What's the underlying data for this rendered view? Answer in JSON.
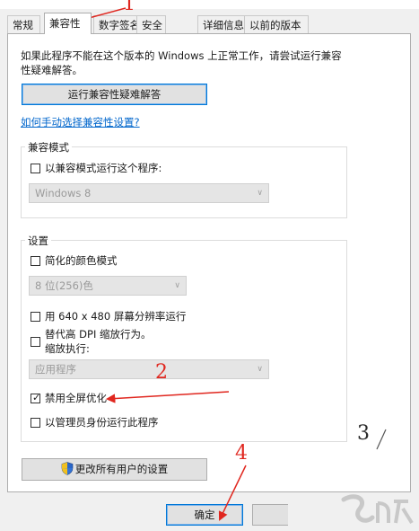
{
  "tabs": [
    {
      "label": "常规",
      "active": false
    },
    {
      "label": "兼容性",
      "active": true
    },
    {
      "label": "数字签名",
      "active": false
    },
    {
      "label": "安全",
      "active": false
    },
    {
      "label": "详细信息",
      "active": false
    },
    {
      "label": "以前的版本",
      "active": false
    }
  ],
  "intro": {
    "line1": "如果此程序不能在这个版本的 Windows 上正常工作，请尝试运行兼容",
    "line2": "性疑难解答。"
  },
  "troubleshooter_button": "运行兼容性疑难解答",
  "manual_link": "如何手动选择兼容性设置?",
  "compat_mode": {
    "legend": "兼容模式",
    "checkbox_label": "以兼容模式运行这个程序:",
    "checked": false,
    "os_selected": "Windows 8"
  },
  "settings": {
    "legend": "设置",
    "reduced_color_label": "简化的颜色模式",
    "reduced_color_checked": false,
    "color_selected": "8 位(256)色",
    "res_640_label": "用 640 x 480 屏幕分辨率运行",
    "res_640_checked": false,
    "dpi_line1": "替代高 DPI 缩放行为。",
    "dpi_line2": "缩放执行:",
    "dpi_checked": false,
    "dpi_selected": "应用程序",
    "fullscreen_label": "禁用全屏优化",
    "fullscreen_checked": true,
    "admin_label": "以管理员身份运行此程序",
    "admin_checked": false
  },
  "all_users_button": "更改所有用户的设置",
  "ok_button": "确定",
  "annotations": [
    "1",
    "2",
    "3",
    "4"
  ],
  "colors": {
    "annotation": "#e0271f",
    "focus": "#0078d7",
    "link": "#0066cc"
  }
}
